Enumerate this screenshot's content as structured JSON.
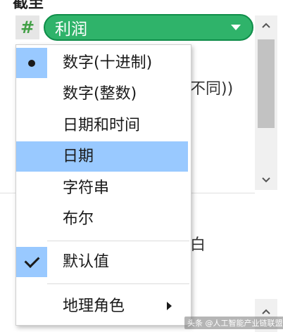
{
  "background": {
    "top_partial": "截至",
    "partial_right_text": "不同))",
    "partial_bottom_text": "白"
  },
  "field": {
    "type_symbol": "#",
    "name": "利润"
  },
  "menu": {
    "items": [
      {
        "label": "数字(十进制)",
        "state": "selected-dot"
      },
      {
        "label": "数字(整数)",
        "state": "none"
      },
      {
        "label": "日期和时间",
        "state": "none"
      },
      {
        "label": "日期",
        "state": "hover"
      },
      {
        "label": "字符串",
        "state": "none"
      },
      {
        "label": "布尔",
        "state": "none"
      },
      {
        "label": "默认值",
        "state": "checked"
      },
      {
        "label": "地理角色",
        "state": "submenu"
      }
    ]
  },
  "scrollbar": {
    "up_icon": "chevron-up-icon",
    "down_icon": "chevron-down-icon"
  },
  "colors": {
    "pill_green": "#2fb36a",
    "hash_green": "#43a047",
    "highlight_blue": "#99c9ff"
  },
  "watermark": {
    "text": "头条 @人工智能产业链联盟"
  }
}
